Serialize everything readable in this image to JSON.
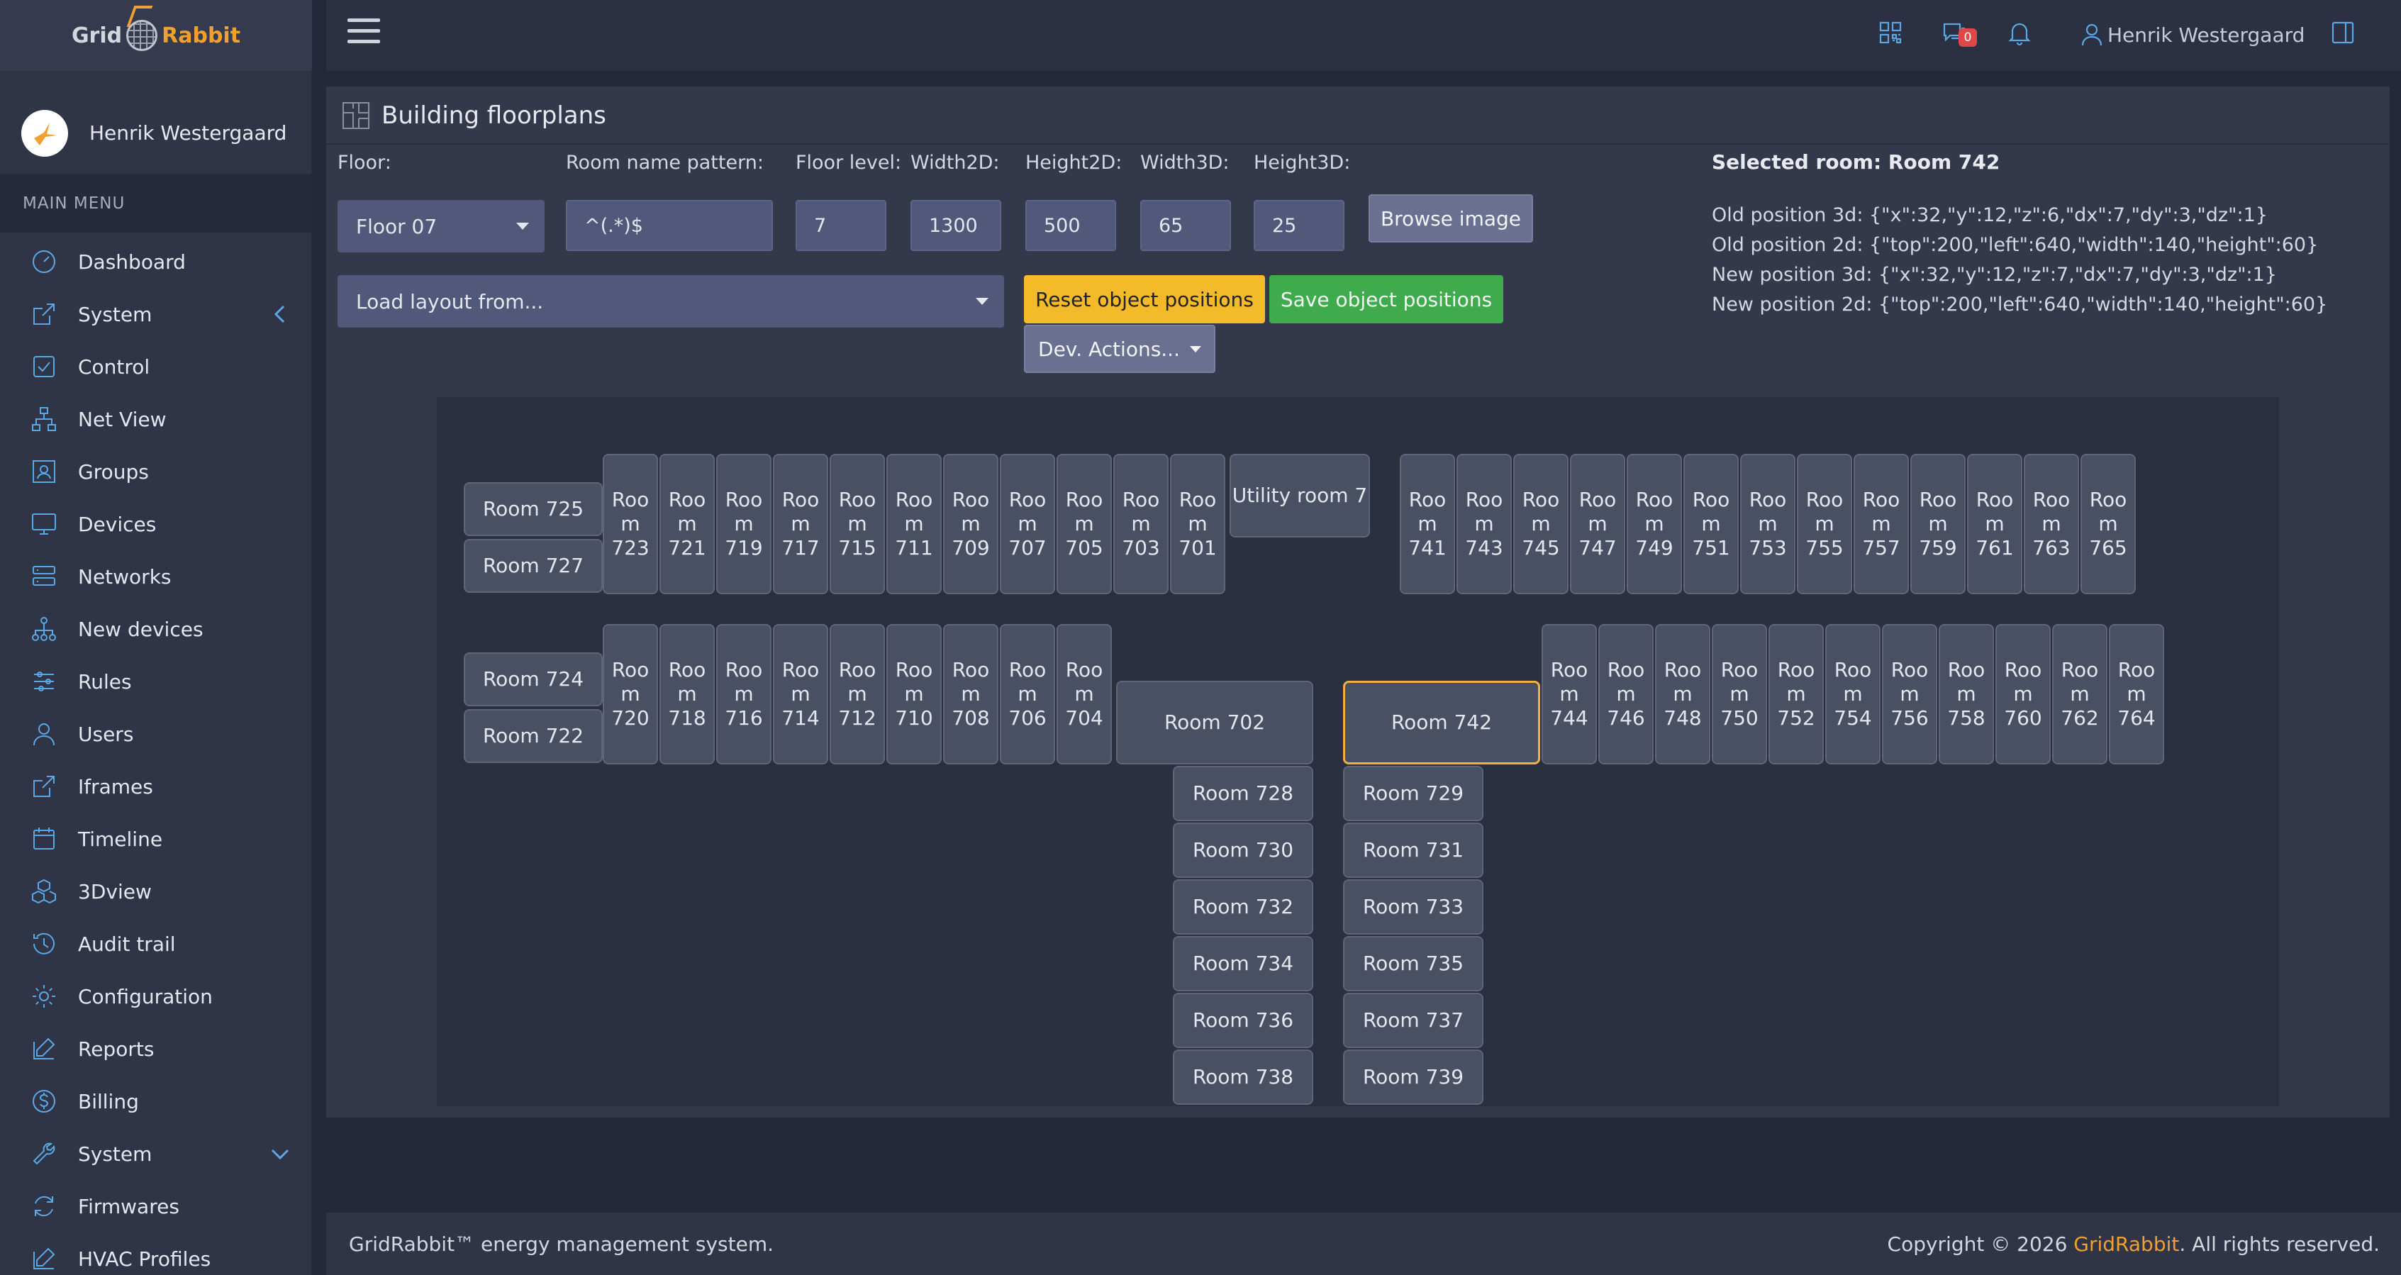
{
  "brand": {
    "part1": "Grid",
    "part2": "Rabbit"
  },
  "user": {
    "name": "Henrik Westergaard"
  },
  "menu_header": "MAIN MENU",
  "menu": [
    {
      "label": "Dashboard",
      "icon": "dashboard-icon"
    },
    {
      "label": "System",
      "icon": "external-link-icon",
      "chevron": "left"
    },
    {
      "label": "Control",
      "icon": "checkbox-icon"
    },
    {
      "label": "Net View",
      "icon": "network-tree-icon"
    },
    {
      "label": "Groups",
      "icon": "groups-icon"
    },
    {
      "label": "Devices",
      "icon": "monitor-icon"
    },
    {
      "label": "Networks",
      "icon": "server-icon"
    },
    {
      "label": "New devices",
      "icon": "hierarchy-icon"
    },
    {
      "label": "Rules",
      "icon": "sliders-icon"
    },
    {
      "label": "Users",
      "icon": "user-icon"
    },
    {
      "label": "Iframes",
      "icon": "external-link-icon"
    },
    {
      "label": "Timeline",
      "icon": "calendar-icon"
    },
    {
      "label": "3Dview",
      "icon": "cubes-icon"
    },
    {
      "label": "Audit trail",
      "icon": "history-icon"
    },
    {
      "label": "Configuration",
      "icon": "gear-icon"
    },
    {
      "label": "Reports",
      "icon": "edit-icon"
    },
    {
      "label": "Billing",
      "icon": "dollar-icon"
    },
    {
      "label": "System",
      "icon": "wrench-icon",
      "chevron": "down"
    },
    {
      "label": "Firmwares",
      "icon": "refresh-icon"
    },
    {
      "label": "HVAC Profiles",
      "icon": "edit-icon"
    }
  ],
  "topbar": {
    "chat_badge": "0",
    "user_name": "Henrik Westergaard"
  },
  "page": {
    "title": "Building floorplans"
  },
  "form": {
    "floor_label": "Floor:",
    "floor_value": "Floor 07",
    "pattern_label": "Room name pattern:",
    "pattern_value": "^(.*)$",
    "level_label": "Floor level:",
    "level_value": "7",
    "width2d_label": "Width2D:",
    "width2d_value": "1300",
    "height2d_label": "Height2D:",
    "height2d_value": "500",
    "width3d_label": "Width3D:",
    "width3d_value": "65",
    "height3d_label": "Height3D:",
    "height3d_value": "25",
    "browse_button": "Browse image",
    "load_layout": "Load layout from...",
    "reset_button": "Reset object positions",
    "save_button": "Save object positions",
    "dev_actions": "Dev. Actions..."
  },
  "selected": {
    "title": "Selected room: Room 742",
    "old3d": "Old position 3d: {\"x\":32,\"y\":12,\"z\":6,\"dx\":7,\"dy\":3,\"dz\":1}",
    "old2d": "Old position 2d: {\"top\":200,\"left\":640,\"width\":140,\"height\":60}",
    "new3d": "New position 3d: {\"x\":32,\"y\":12,\"z\":7,\"dx\":7,\"dy\":3,\"dz\":1}",
    "new2d": "New position 2d: {\"top\":200,\"left\":640,\"width\":140,\"height\":60}"
  },
  "rooms": {
    "top_left_stack": [
      "Room 725",
      "Room 727"
    ],
    "top_left_row": [
      "Room 723",
      "Room 721",
      "Room 719",
      "Room 717",
      "Room 715",
      "Room 711",
      "Room 709",
      "Room 707",
      "Room 705",
      "Room 703",
      "Room 701"
    ],
    "utility": "Utility room 7",
    "top_right_row": [
      "Room 741",
      "Room 743",
      "Room 745",
      "Room 747",
      "Room 749",
      "Room 751",
      "Room 753",
      "Room 755",
      "Room 757",
      "Room 759",
      "Room 761",
      "Room 763",
      "Room 765"
    ],
    "mid_left_stack": [
      "Room 724",
      "Room 722"
    ],
    "mid_left_row": [
      "Room 720",
      "Room 718",
      "Room 716",
      "Room 714",
      "Room 712",
      "Room 710",
      "Room 708",
      "Room 706",
      "Room 704"
    ],
    "room_702": "Room 702",
    "room_742": "Room 742",
    "mid_right_row": [
      "Room 744",
      "Room 746",
      "Room 748",
      "Room 750",
      "Room 752",
      "Room 754",
      "Room 756",
      "Room 758",
      "Room 760",
      "Room 762",
      "Room 764"
    ],
    "col_left": [
      "Room 728",
      "Room 730",
      "Room 732",
      "Room 734",
      "Room 736",
      "Room 738"
    ],
    "col_right": [
      "Room 729",
      "Room 731",
      "Room 733",
      "Room 735",
      "Room 737",
      "Room 739"
    ]
  },
  "footer": {
    "left": "GridRabbit™ energy management system.",
    "right_prefix": "Copyright © 2026 ",
    "right_link": "GridRabbit",
    "right_suffix": ". All rights reserved."
  },
  "colors": {
    "accent": "#5aa9e6",
    "brand_orange": "#f0a030",
    "selected_border": "#f0b040",
    "reset": "#f3bb2a",
    "save": "#3fab4d"
  }
}
